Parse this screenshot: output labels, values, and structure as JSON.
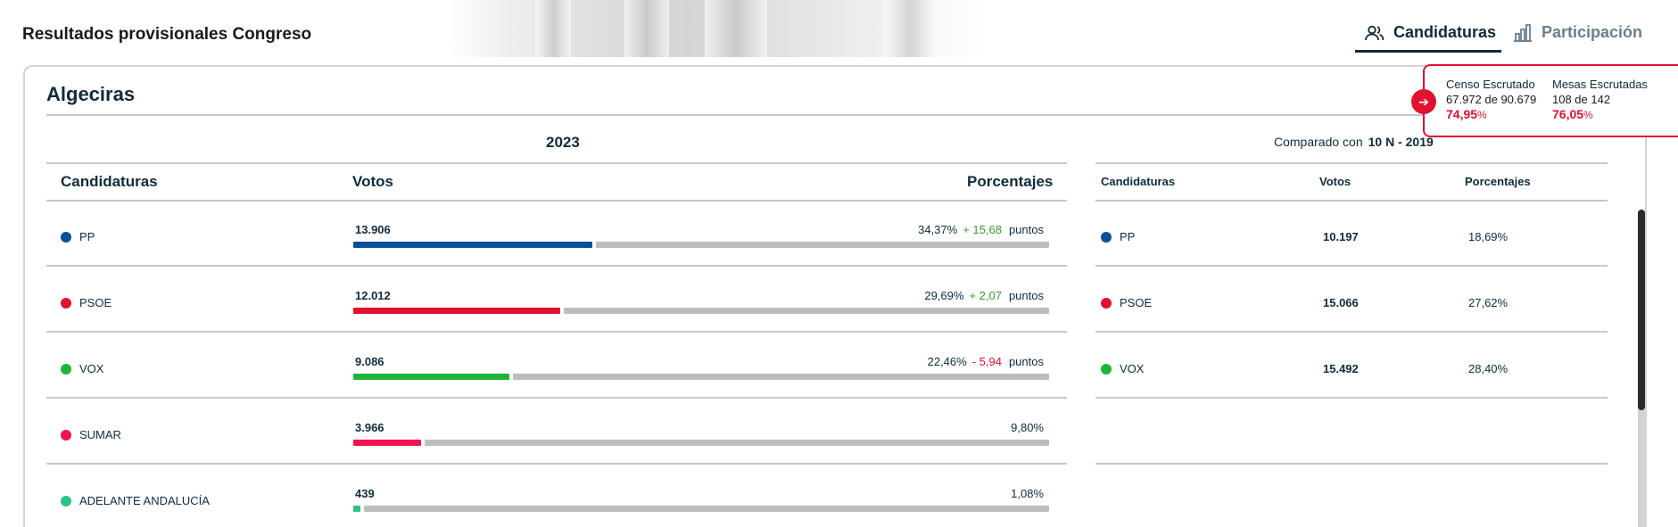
{
  "header": {
    "title": "Resultados provisionales Congreso",
    "tabs": [
      {
        "label": "Candidaturas",
        "icon": "users-icon",
        "active": true
      },
      {
        "label": "Participación",
        "icon": "bar-chart-icon",
        "active": false
      }
    ]
  },
  "main": {
    "location": "Algeciras",
    "year": "2023",
    "compare_label": "Comparado con",
    "compare_election": "10 N - 2019",
    "columns": {
      "party": "Candidaturas",
      "votes": "Votos",
      "pct": "Porcentajes"
    },
    "compare_columns": {
      "party": "Candidaturas",
      "votes": "Votos",
      "pct": "Porcentajes"
    },
    "rows": [
      {
        "party": "PP",
        "color": "#0b4f9c",
        "votes": "13.906",
        "pct": "34,37%",
        "diff": "+ 15,68",
        "diff_sign": "pos",
        "unit": "puntos",
        "bar_fraction": 0.3437
      },
      {
        "party": "PSOE",
        "color": "#e0122f",
        "votes": "12.012",
        "pct": "29,69%",
        "diff": "+ 2,07",
        "diff_sign": "pos",
        "unit": "puntos",
        "bar_fraction": 0.2969
      },
      {
        "party": "VOX",
        "color": "#1fb53a",
        "votes": "9.086",
        "pct": "22,46%",
        "diff": "- 5,94",
        "diff_sign": "neg",
        "unit": "puntos",
        "bar_fraction": 0.2246
      },
      {
        "party": "SUMAR",
        "color": "#f0134f",
        "votes": "3.966",
        "pct": "9,80%",
        "diff": "",
        "diff_sign": "",
        "unit": "",
        "bar_fraction": 0.098
      },
      {
        "party": "ADELANTE ANDALUCÍA",
        "color": "#2cc387",
        "votes": "439",
        "pct": "1,08%",
        "diff": "",
        "diff_sign": "",
        "unit": "",
        "bar_fraction": 0.0108
      }
    ],
    "compare_rows": [
      {
        "party": "PP",
        "color": "#0b4f9c",
        "votes": "10.197",
        "pct": "18,69%"
      },
      {
        "party": "PSOE",
        "color": "#e0122f",
        "votes": "15.066",
        "pct": "27,62%"
      },
      {
        "party": "VOX",
        "color": "#1fb53a",
        "votes": "15.492",
        "pct": "28,40%"
      }
    ]
  },
  "escrutinio": {
    "censo_label": "Censo Escrutado",
    "censo_value": "67.972 de 90.679",
    "censo_pct": "74,95",
    "mesas_label": "Mesas Escrutadas",
    "mesas_value": "108 de 142",
    "mesas_pct": "76,05",
    "pct_sign": "%",
    "arrow_icon": "arrow-right-icon"
  }
}
